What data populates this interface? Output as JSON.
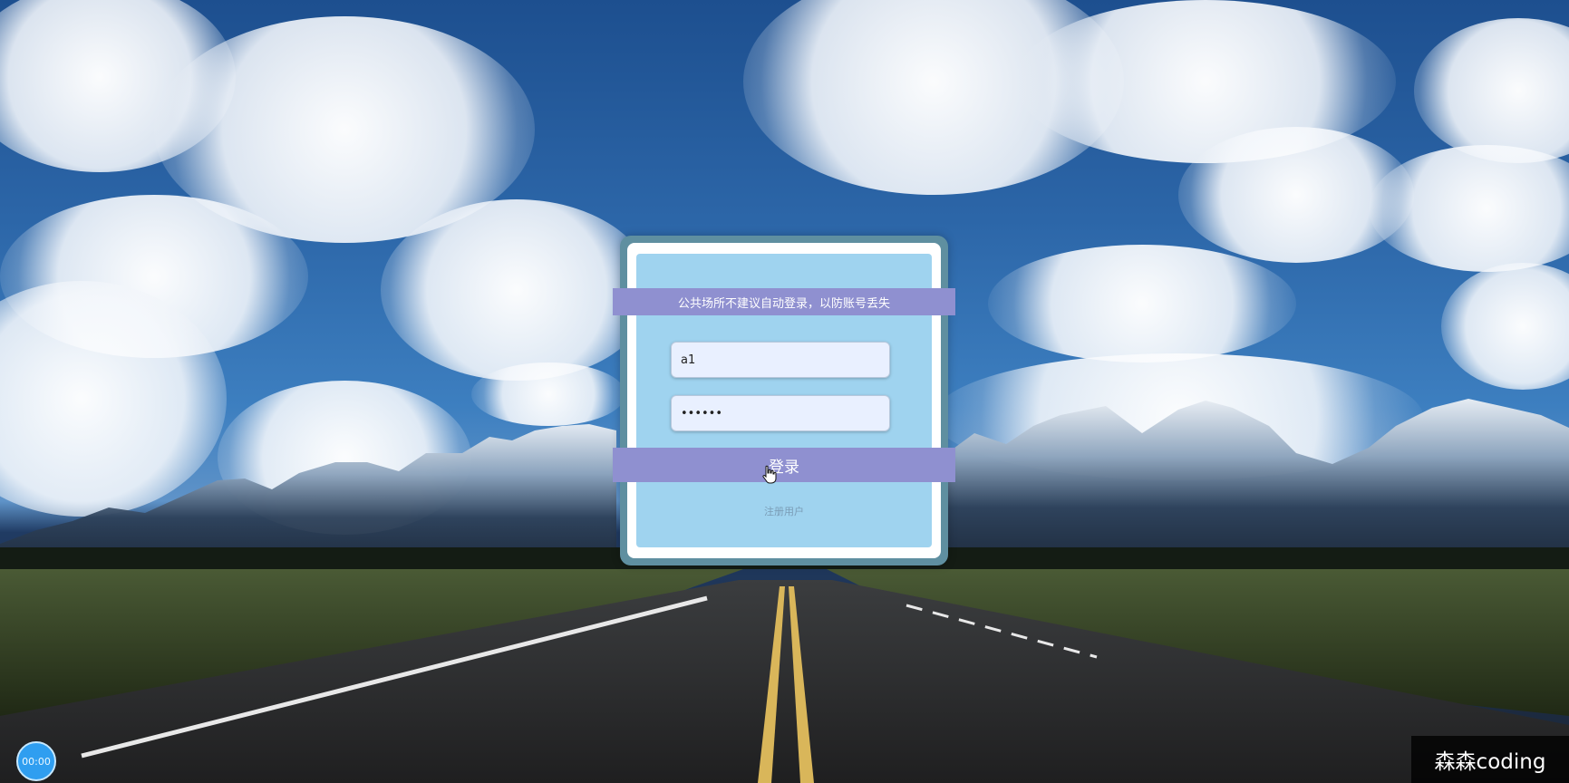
{
  "notice": "公共场所不建议自动登录，以防账号丢失",
  "login_form": {
    "username_value": "a1",
    "password_value": "123456",
    "login_label": "登录",
    "register_label": "注册用户"
  },
  "timer": "00:00",
  "watermark": "森森coding",
  "colors": {
    "frame": "#5f8fa0",
    "panel": "#9fd3ef",
    "bar": "#8f90d0",
    "field": "#e9f0ff"
  },
  "icons": {
    "cursor": "hand-pointer-icon"
  }
}
